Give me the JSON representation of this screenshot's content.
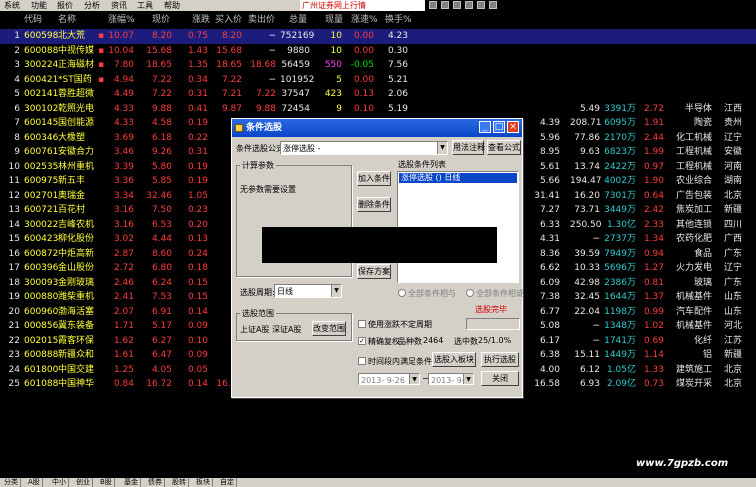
{
  "menu": [
    "系统",
    "功能",
    "报价",
    "分析",
    "资讯",
    "工具",
    "帮助"
  ],
  "ticker_text": "广州证券网上行情",
  "headers": [
    "代码",
    "名称",
    "涨幅%",
    "现价",
    "涨跌",
    "买入价",
    "卖出价",
    "总量",
    "现量",
    "涨速%",
    "换手%"
  ],
  "rows": [
    {
      "n": "1",
      "code": "600598",
      "name": "北大荒",
      "chg": "10.07",
      "price": "8.20",
      "diff": "0.75",
      "bid": "8.20",
      "ask": "−",
      "vol": "752169",
      "cur": "10",
      "speed": "0.00",
      "turn": "4.23"
    },
    {
      "n": "2",
      "code": "600088",
      "name": "中视传媒",
      "chg": "10.04",
      "price": "15.68",
      "diff": "1.43",
      "bid": "15.68",
      "ask": "−",
      "vol": "9880",
      "cur": "10",
      "speed": "0.00",
      "turn": "0.30"
    },
    {
      "n": "3",
      "code": "300224",
      "name": "正海磁材",
      "chg": "7.80",
      "price": "18.65",
      "diff": "1.35",
      "bid": "18.65",
      "ask": "18.68",
      "vol": "56459",
      "cur": "550",
      "speed": "-0.05",
      "turn": "7.56"
    },
    {
      "n": "4",
      "code": "600421",
      "name": "*ST国药",
      "chg": "4.94",
      "price": "7.22",
      "diff": "0.34",
      "bid": "7.22",
      "ask": "−",
      "vol": "101952",
      "cur": "5",
      "speed": "0.00",
      "turn": "5.21"
    },
    {
      "n": "5",
      "code": "002141",
      "name": "蓉胜超微",
      "chg": "4.49",
      "price": "7.22",
      "diff": "0.31",
      "bid": "7.21",
      "ask": "7.22",
      "vol": "37547",
      "cur": "423",
      "speed": "0.13",
      "turn": "2.06"
    },
    {
      "n": "6",
      "code": "300102",
      "name": "乾照光电",
      "chg": "4.33",
      "price": "9.88",
      "diff": "0.41",
      "bid": "9.87",
      "ask": "9.88",
      "vol": "72454",
      "cur": "9",
      "speed": "0.10",
      "turn": "5.19"
    },
    {
      "n": "7",
      "code": "600145",
      "name": "国创能源",
      "chg": "4.33",
      "price": "4.58",
      "diff": "0.19",
      "e": "4.39",
      "f": "208.71",
      "g": "6095万",
      "h": "1.91",
      "i": "陶瓷",
      "j": "贵州"
    },
    {
      "n": "8",
      "code": "600346",
      "name": "大橡塑",
      "chg": "3.69",
      "price": "6.18",
      "diff": "0.22",
      "e": "5.96",
      "f": "77.86",
      "g": "2170万",
      "h": "2.44",
      "i": "化工机械",
      "j": "辽宁"
    },
    {
      "n": "9",
      "code": "600761",
      "name": "安徽合力",
      "chg": "3.46",
      "price": "9.26",
      "diff": "0.31",
      "e": "8.95",
      "f": "9.63",
      "g": "6823万",
      "h": "1.99",
      "i": "工程机械",
      "j": "安徽"
    },
    {
      "n": "10",
      "code": "002535",
      "name": "林州重机",
      "chg": "3.39",
      "price": "5.80",
      "diff": "0.19",
      "e": "5.61",
      "f": "13.74",
      "g": "2422万",
      "h": "0.97",
      "i": "工程机械",
      "j": "河南"
    },
    {
      "n": "11",
      "code": "600975",
      "name": "新五丰",
      "chg": "3.36",
      "price": "5.85",
      "diff": "0.19",
      "e": "5.66",
      "f": "194.47",
      "g": "4002万",
      "h": "1.90",
      "i": "农业综合",
      "j": "湖南"
    },
    {
      "n": "12",
      "code": "002701",
      "name": "奥瑞金",
      "chg": "3.34",
      "price": "32.46",
      "diff": "1.05",
      "e": "31.41",
      "f": "16.20",
      "g": "7301万",
      "h": "0.64",
      "i": "广告包装",
      "j": "北京"
    },
    {
      "n": "13",
      "code": "600721",
      "name": "百花村",
      "chg": "3.16",
      "price": "7.50",
      "diff": "0.23",
      "e": "7.27",
      "f": "73.71",
      "g": "3449万",
      "h": "2.42",
      "i": "焦炭加工",
      "j": "新疆"
    },
    {
      "n": "14",
      "code": "300022",
      "name": "吉峰农机",
      "chg": "3.16",
      "price": "6.53",
      "diff": "0.20",
      "e": "6.33",
      "f": "250.50",
      "g": "1.30亿",
      "h": "2.33",
      "i": "其他连锁",
      "j": "四川"
    },
    {
      "n": "15",
      "code": "600423",
      "name": "柳化股份",
      "chg": "3.02",
      "price": "4.44",
      "diff": "0.13",
      "e": "4.31",
      "f": "−",
      "g": "2737万",
      "h": "1.34",
      "i": "农药化肥",
      "j": "广西"
    },
    {
      "n": "16",
      "code": "600872",
      "name": "中炬高新",
      "chg": "2.87",
      "price": "8.60",
      "diff": "0.24",
      "e": "8.36",
      "f": "39.59",
      "g": "7949万",
      "h": "0.94",
      "i": "食品",
      "j": "广东"
    },
    {
      "n": "17",
      "code": "600396",
      "name": "金山股份",
      "chg": "2.72",
      "price": "6.80",
      "diff": "0.18",
      "e": "6.62",
      "f": "10.33",
      "g": "5696万",
      "h": "1.27",
      "i": "火力发电",
      "j": "辽宁"
    },
    {
      "n": "18",
      "code": "300093",
      "name": "金刚玻璃",
      "chg": "2.46",
      "price": "6.24",
      "diff": "0.15",
      "e": "6.09",
      "f": "42.98",
      "g": "2386万",
      "h": "0.81",
      "i": "玻璃",
      "j": "广东"
    },
    {
      "n": "19",
      "code": "000880",
      "name": "潍柴重机",
      "chg": "2.41",
      "price": "7.53",
      "diff": "0.15",
      "e": "7.38",
      "f": "32.45",
      "g": "1644万",
      "h": "1.37",
      "i": "机械基件",
      "j": "山东"
    },
    {
      "n": "20",
      "code": "600960",
      "name": "渤海活塞",
      "chg": "2.07",
      "price": "6.91",
      "diff": "0.14",
      "e": "6.77",
      "f": "22.04",
      "g": "1198万",
      "h": "0.99",
      "i": "汽车配件",
      "j": "山东"
    },
    {
      "n": "21",
      "code": "000856",
      "name": "冀东装备",
      "chg": "1.71",
      "price": "5.17",
      "diff": "0.09",
      "e": "5.08",
      "f": "−",
      "g": "1348万",
      "h": "1.02",
      "i": "机械基件",
      "j": "河北"
    },
    {
      "n": "22",
      "code": "002015",
      "name": "霞客环保",
      "chg": "1.62",
      "price": "6.27",
      "diff": "0.10",
      "e": "6.17",
      "f": "−",
      "g": "1741万",
      "h": "0.69",
      "i": "化纤",
      "j": "江苏"
    },
    {
      "n": "23",
      "code": "600888",
      "name": "新疆众和",
      "chg": "1.61",
      "price": "6.47",
      "diff": "0.09",
      "e": "6.38",
      "f": "15.11",
      "g": "1449万",
      "h": "1.14",
      "i": "铝",
      "j": "新疆"
    },
    {
      "n": "24",
      "code": "601800",
      "name": "中国交建",
      "chg": "1.25",
      "price": "4.05",
      "diff": "0.05",
      "e": "4.00",
      "f": "6.12",
      "g": "1.05亿",
      "h": "1.33",
      "i": "建筑施工",
      "j": "北京"
    },
    {
      "n": "25",
      "code": "601088",
      "name": "中国神华",
      "chg": "0.84",
      "price": "16.72",
      "diff": "0.14",
      "bid": "16.72",
      "ask": "16.73",
      "vol": "124988",
      "cur": "17",
      "speed": "-0.11",
      "turn": "0.00",
      "x1": "16.66",
      "x2": "16.72",
      "x3": "16.54",
      "e": "16.58",
      "f": "6.93",
      "g": "2.09亿",
      "h": "0.73",
      "i": "煤炭开采",
      "j": "北京"
    }
  ],
  "partial_row6": {
    "a": "5.49",
    "b": "3391万",
    "c": "2.72",
    "d": "半导体",
    "e": "江西"
  },
  "dialog": {
    "title": "条件选股",
    "formula_label": "条件选股公式",
    "formula_value": "涨停选股 -",
    "btn_usage": "用法注释",
    "btn_view": "查看公式",
    "calc_params": "计算参数",
    "no_params": "无参数需要设置",
    "btn_add": "加入条件",
    "btn_delete": "删除条件",
    "btn_save": "保存方案",
    "list_title": "选股条件列表",
    "list_item": "涨停选股 () 日线",
    "period_label": "选股周期:",
    "period_value": "日线",
    "radio_and": "全部条件相与",
    "radio_or": "全部条件相或",
    "done": "选股完毕",
    "scope_title": "选股范围",
    "scope_text": "上证A股 深证A股",
    "btn_change": "改变范围",
    "chk_nonfixed": "使用涨跌不定周期",
    "chk_exright": "精确复权",
    "total_label": "品种数",
    "total_value": "2464",
    "selected_label": "选中数",
    "selected_value": "25/1.0%",
    "chk_time": "时间段内满足条件",
    "btn_to_block": "选股入板块",
    "btn_run": "执行选股",
    "btn_close": "关闭",
    "date_from": "2013- 9-26",
    "date_to": "2013- 9- 2"
  },
  "tabs": [
    "分类",
    "A股",
    "中小",
    "创业",
    "B股",
    "基金",
    "债券",
    "股转",
    "板块",
    "自定"
  ],
  "watermark": "www.7gpzb.com"
}
